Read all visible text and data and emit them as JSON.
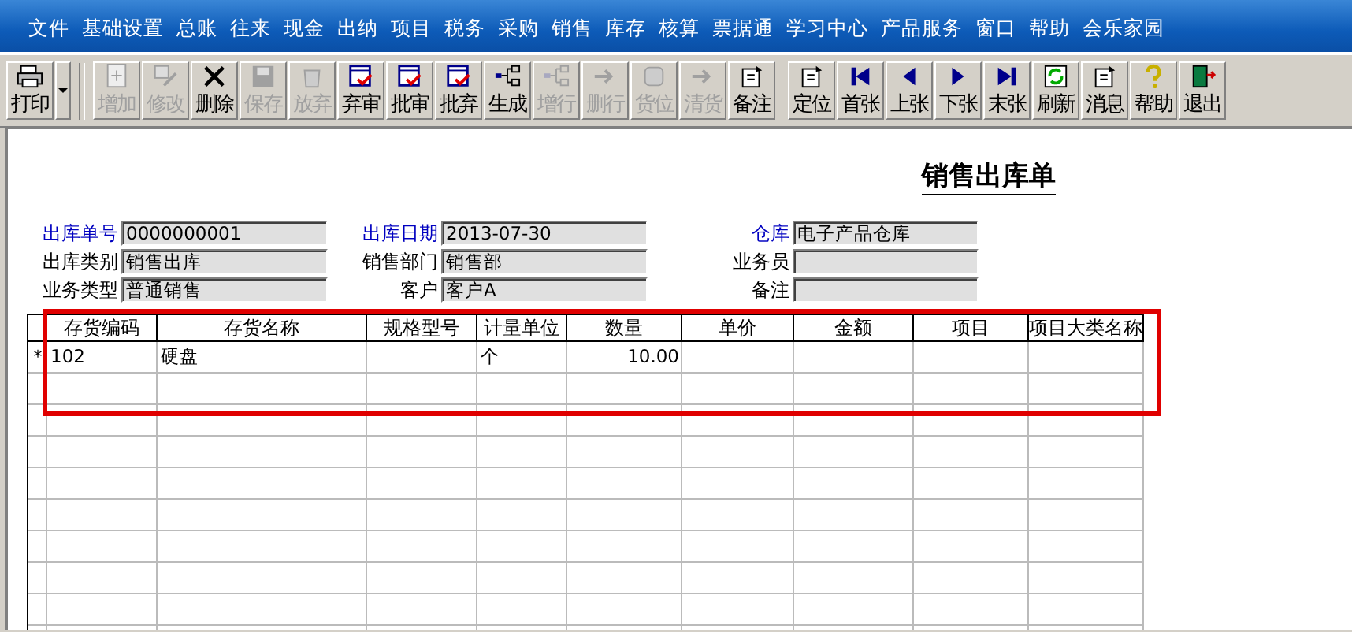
{
  "menu": [
    "文件",
    "基础设置",
    "总账",
    "往来",
    "现金",
    "出纳",
    "项目",
    "税务",
    "采购",
    "销售",
    "库存",
    "核算",
    "票据通",
    "学习中心",
    "产品服务",
    "窗口",
    "帮助",
    "会乐家园"
  ],
  "toolbar": [
    {
      "label": "打印",
      "kind": "print",
      "disabled": false,
      "dropdown": true
    },
    {
      "label": "增加",
      "kind": "add",
      "disabled": true
    },
    {
      "label": "修改",
      "kind": "edit",
      "disabled": true
    },
    {
      "label": "删除",
      "kind": "delete",
      "disabled": false
    },
    {
      "label": "保存",
      "kind": "save",
      "disabled": true
    },
    {
      "label": "放弃",
      "kind": "discard",
      "disabled": true
    },
    {
      "label": "弃审",
      "kind": "audit",
      "disabled": false
    },
    {
      "label": "批审",
      "kind": "audit",
      "disabled": false
    },
    {
      "label": "批弃",
      "kind": "audit",
      "disabled": false
    },
    {
      "label": "生成",
      "kind": "branch",
      "disabled": false
    },
    {
      "label": "增行",
      "kind": "branch",
      "disabled": true
    },
    {
      "label": "删行",
      "kind": "move",
      "disabled": true
    },
    {
      "label": "货位",
      "kind": "location",
      "disabled": true
    },
    {
      "label": "清货",
      "kind": "move",
      "disabled": true
    },
    {
      "label": "备注",
      "kind": "note",
      "disabled": false
    },
    {
      "label": "定位",
      "kind": "note",
      "disabled": false
    },
    {
      "label": "首张",
      "kind": "first",
      "disabled": false
    },
    {
      "label": "上张",
      "kind": "prev",
      "disabled": false
    },
    {
      "label": "下张",
      "kind": "next",
      "disabled": false
    },
    {
      "label": "末张",
      "kind": "last",
      "disabled": false
    },
    {
      "label": "刷新",
      "kind": "refresh",
      "disabled": false
    },
    {
      "label": "消息",
      "kind": "note",
      "disabled": false
    },
    {
      "label": "帮助",
      "kind": "help",
      "disabled": false
    },
    {
      "label": "退出",
      "kind": "exit",
      "disabled": false
    }
  ],
  "form": {
    "title": "销售出库单",
    "fields": [
      {
        "label": "出库单号",
        "value": "0000000001",
        "required": true
      },
      {
        "label": "出库日期",
        "value": "2013-07-30",
        "required": true
      },
      {
        "label": "仓库",
        "value": "电子产品仓库",
        "required": true
      },
      {
        "label": "出库类别",
        "value": "销售出库",
        "required": false
      },
      {
        "label": "销售部门",
        "value": "销售部",
        "required": false
      },
      {
        "label": "业务员",
        "required": false
      },
      {
        "label": "业务类型",
        "value": "普通销售",
        "required": false
      },
      {
        "label": "客户",
        "value": "客户A",
        "required": false
      },
      {
        "label": "备注",
        "required": false
      }
    ]
  },
  "table": {
    "columns": [
      {
        "label": "存货编码",
        "kind": "text"
      },
      {
        "label": "存货名称",
        "kind": "text"
      },
      {
        "label": "规格型号",
        "kind": "text"
      },
      {
        "label": "计量单位",
        "kind": "text"
      },
      {
        "label": "数量",
        "kind": "number"
      },
      {
        "label": "单价",
        "kind": "number"
      },
      {
        "label": "金额",
        "kind": "number"
      },
      {
        "label": "项目",
        "kind": "text"
      },
      {
        "label": "项目大类名称",
        "kind": "text"
      }
    ],
    "rows": [
      {
        "marker": "*",
        "cells": [
          "102",
          "硬盘",
          "",
          "个",
          "10.00",
          "",
          "",
          "",
          ""
        ]
      }
    ]
  }
}
